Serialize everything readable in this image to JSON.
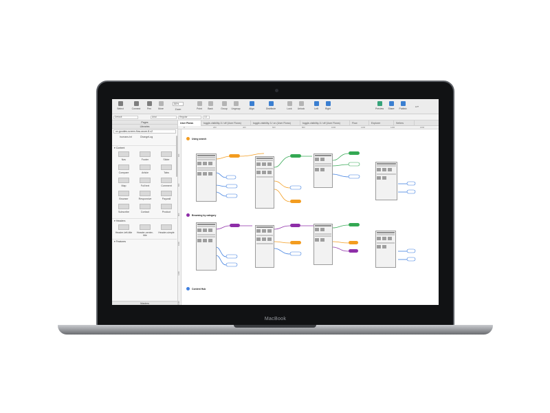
{
  "device": {
    "brand": "MacBook"
  },
  "toolbar": {
    "select_label": "Select",
    "connect_label": "Connect",
    "pen_label": "Pen",
    "more_label": "More",
    "zoom_value": "50%",
    "zoom_label": "Zoom",
    "point_label": "Point",
    "back_label": "Back",
    "group_label": "Group",
    "ungroup_label": "Ungroup",
    "align_label": "Align",
    "distribute_label": "Distribute",
    "lock_label": "Lock",
    "unlock_label": "Unlock",
    "left_label": "Left",
    "right_label": "Right",
    "preview_label": "Preview",
    "share_label": "Share",
    "publish_label": "Publish"
  },
  "stylebar": {
    "style_value": "Default",
    "font_value": "Arial",
    "weight_value": "Regular",
    "size_value": "13"
  },
  "left_pane": {
    "pages_header": "Pages",
    "libraries_header": "Libraries",
    "library_select": "ux-goodies-screen-flow-axure-8-v2",
    "top_items": [
      "humans.txt",
      "ChangeLog"
    ],
    "sections": [
      {
        "title": "Content",
        "items": [
          "Nav",
          "Footer",
          "Slider",
          "Compare",
          "Article",
          "Tabs",
          "Map",
          "Full text",
          "Comment",
          "Browser",
          "Responsive",
          "Paywall",
          "Subscribe",
          "Contact",
          "Product"
        ]
      },
      {
        "title": "Headers",
        "items": [
          "Header-left-title",
          "Header-center-title",
          "Header-simple"
        ]
      },
      {
        "title": "Features",
        "items": []
      }
    ],
    "masters_header": "Masters"
  },
  "tabs": [
    "User Flows",
    "toggle-visibility-3 / off (User Flows)",
    "toggle-visibility-3 / on (User Flows)",
    "toggle-visibility-3 / off (User Flows)",
    "Flow",
    "Explorer",
    "Sellers"
  ],
  "canvas": {
    "ruler_h": [
      "0",
      "200",
      "400",
      "600",
      "800",
      "1000",
      "1200",
      "1400",
      "1600"
    ],
    "ruler_v": [
      "400",
      "600",
      "800",
      "1000",
      "1200",
      "1400"
    ],
    "flow_sections": [
      "Using search",
      "Browsing by category",
      "Content Hub"
    ]
  },
  "colors": {
    "accent_blue": "#3a7fd1",
    "flow_orange": "#f39c1f",
    "flow_green": "#34a853",
    "flow_blue": "#3f7fe0",
    "flow_purple": "#8e2ea8"
  }
}
